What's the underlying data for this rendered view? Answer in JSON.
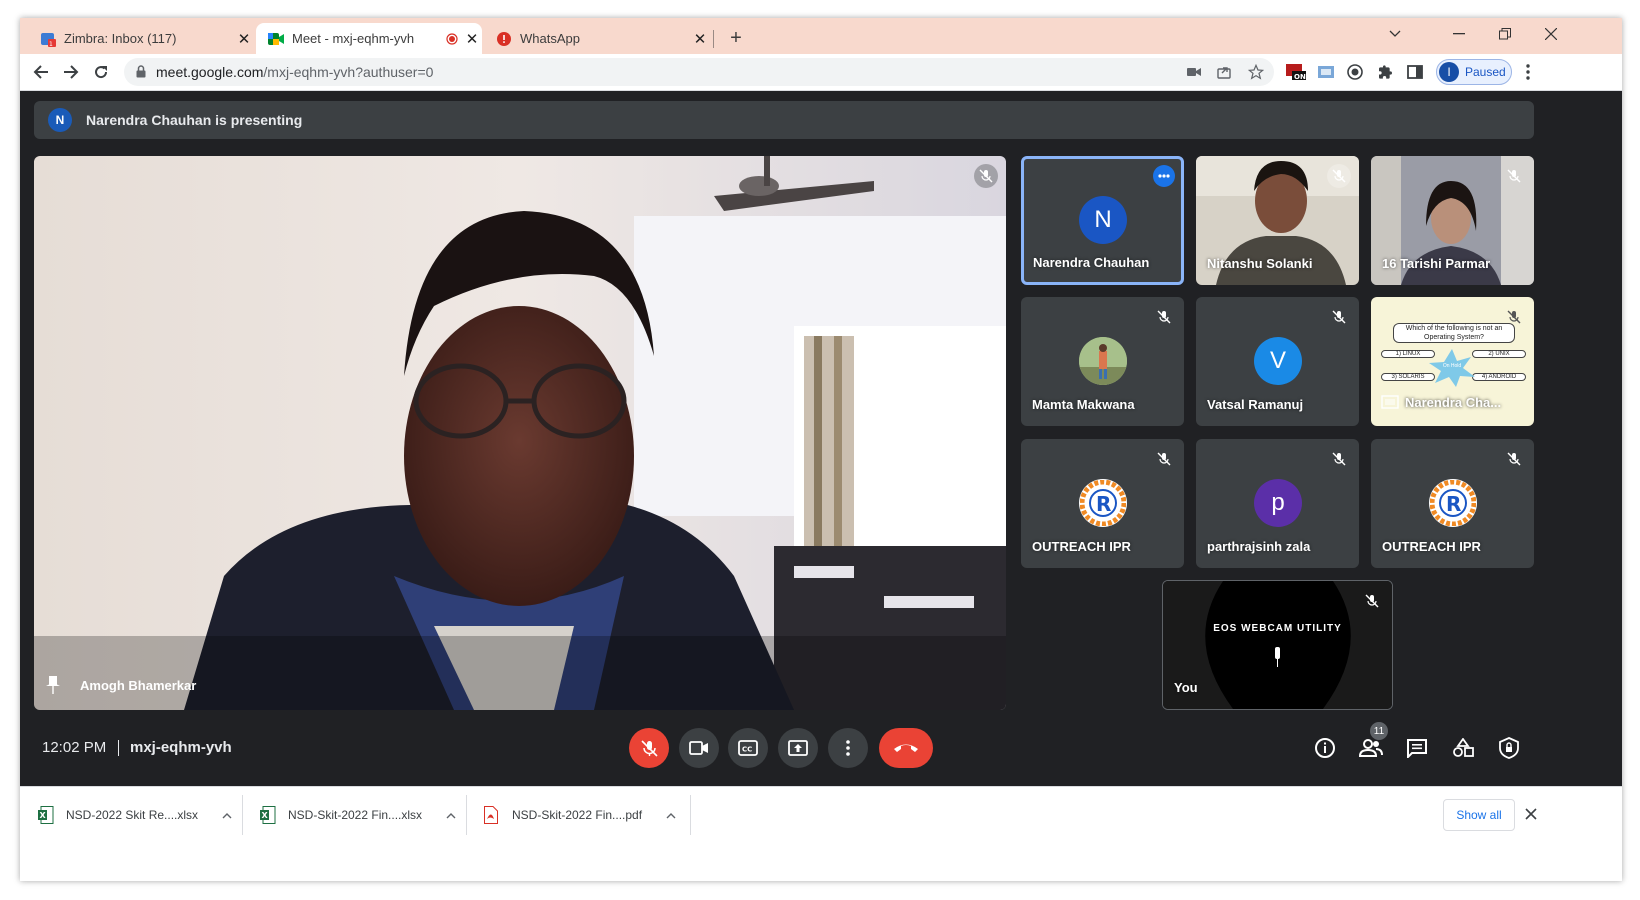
{
  "browser": {
    "tabs": [
      {
        "title": "Zimbra: Inbox (117)",
        "icon": "zimbra-icon",
        "active": false
      },
      {
        "title": "Meet - mxj-eqhm-yvh",
        "icon": "google-meet-icon",
        "active": true,
        "recording": true
      },
      {
        "title": "WhatsApp",
        "icon": "whatsapp-alert-icon",
        "active": false
      }
    ],
    "url_host": "meet.google.com",
    "url_path": "/mxj-eqhm-yvh?authuser=0",
    "profile_initial": "I",
    "profile_status": "Paused"
  },
  "meet": {
    "presenting_banner": {
      "initial": "N",
      "text": "Narendra Chauhan is presenting"
    },
    "main_speaker": {
      "name": "Amogh Bhamerkar"
    },
    "participants": [
      {
        "name": "Narendra Chauhan",
        "initial": "N",
        "avatar_color": "#1a56c4",
        "kind": "avatar",
        "highlighted": true
      },
      {
        "name": "Nitanshu Solanki",
        "kind": "video"
      },
      {
        "name": "16 Tarishi Parmar",
        "kind": "video"
      },
      {
        "name": "Mamta Makwana",
        "kind": "photo"
      },
      {
        "name": "Vatsal Ramanuj",
        "initial": "V",
        "avatar_color": "#1a8ae6",
        "kind": "avatar"
      },
      {
        "name": "Narendra Cha...",
        "kind": "presentation"
      },
      {
        "name": "OUTREACH IPR",
        "kind": "logo"
      },
      {
        "name": "parthrajsinh zala",
        "initial": "p",
        "avatar_color": "#5b2fa8",
        "kind": "avatar"
      },
      {
        "name": "OUTREACH IPR",
        "kind": "logo"
      }
    ],
    "self_tile": {
      "name": "You",
      "webcam_text": "EOS WEBCAM UTILITY"
    },
    "slide": {
      "question": "Which of the following is not an Operating System?",
      "options": [
        "1) LINUX",
        "2) UNIX",
        "3) SOLARIS",
        "4) ANDROID"
      ],
      "center_text": "On Hold"
    },
    "time": "12:02 PM",
    "meeting_code": "mxj-eqhm-yvh",
    "participant_count": "11"
  },
  "downloads": {
    "items": [
      {
        "name": "NSD-2022 Skit Re....xlsx",
        "type": "excel"
      },
      {
        "name": "NSD-Skit-2022 Fin....xlsx",
        "type": "excel"
      },
      {
        "name": "NSD-Skit-2022 Fin....pdf",
        "type": "pdf"
      }
    ],
    "show_all_label": "Show all"
  },
  "colors": {
    "meet_bg": "#202124",
    "end_call": "#ea4335",
    "tab_strip": "#f8d9cd",
    "highlight": "#8ab4f8"
  }
}
